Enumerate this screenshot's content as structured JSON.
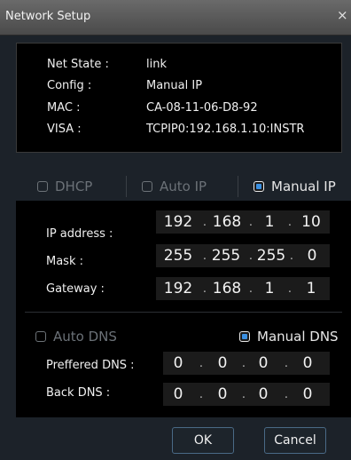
{
  "dialog": {
    "title": "Network Setup",
    "close": "×"
  },
  "info": {
    "net_state_label": "Net State :",
    "net_state": "link",
    "config_label": "Config :",
    "config": "Manual IP",
    "mac_label": "MAC :",
    "mac": "CA-08-11-06-D8-92",
    "visa_label": "VISA :",
    "visa": "TCPIP0:192.168.1.10:INSTR"
  },
  "modes": {
    "dhcp": {
      "label": "DHCP",
      "checked": false
    },
    "auto_ip": {
      "label": "Auto IP",
      "checked": false
    },
    "manual_ip": {
      "label": "Manual IP",
      "checked": true
    }
  },
  "fields": {
    "ip_label": "IP address :",
    "ip": [
      "192",
      "168",
      "1",
      "10"
    ],
    "mask_label": "Mask :",
    "mask": [
      "255",
      "255",
      "255",
      "0"
    ],
    "gateway_label": "Gateway :",
    "gateway": [
      "192",
      "168",
      "1",
      "1"
    ]
  },
  "dns": {
    "auto_dns": {
      "label": "Auto DNS",
      "checked": false
    },
    "manual_dns": {
      "label": "Manual DNS",
      "checked": true
    },
    "preferred_label": "Preffered DNS :",
    "preferred": [
      "0",
      "0",
      "0",
      "0"
    ],
    "back_label": "Back DNS :",
    "back": [
      "0",
      "0",
      "0",
      "0"
    ]
  },
  "buttons": {
    "ok": "OK",
    "cancel": "Cancel"
  },
  "colors": {
    "accent": "#3a8fe0",
    "panel": "#000000",
    "background": "#1c2229"
  }
}
